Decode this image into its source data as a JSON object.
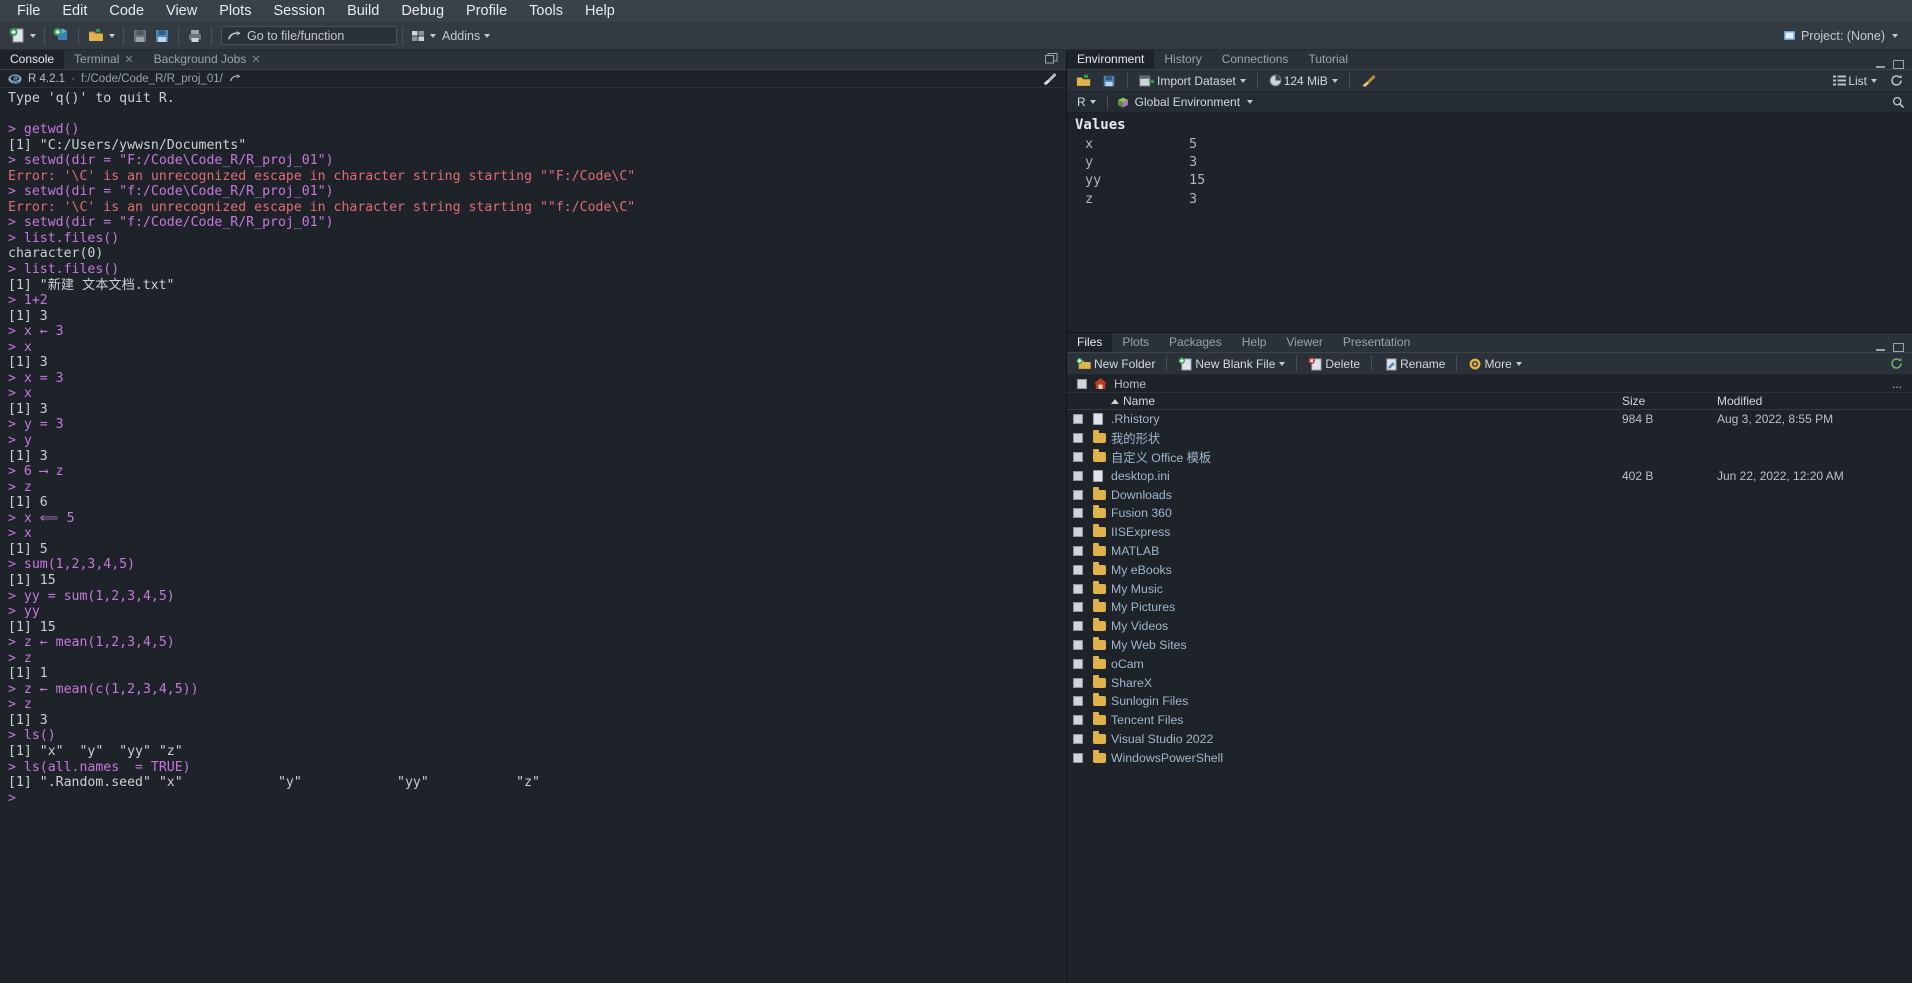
{
  "menubar": {
    "items": [
      {
        "label": "File"
      },
      {
        "label": "Edit"
      },
      {
        "label": "Code"
      },
      {
        "label": "View"
      },
      {
        "label": "Plots"
      },
      {
        "label": "Session"
      },
      {
        "label": "Build"
      },
      {
        "label": "Debug"
      },
      {
        "label": "Profile"
      },
      {
        "label": "Tools"
      },
      {
        "label": "Help"
      }
    ]
  },
  "toolbar": {
    "new_file_icon": "new-file-icon",
    "new_project_icon": "new-project-icon",
    "open_file_icon": "open-file-icon",
    "save_icon": "save-icon",
    "save_all_icon": "save-all-icon",
    "print_icon": "print-icon",
    "goto_icon": "goto-arrow-icon",
    "goto_label": "Go to file/function",
    "panes_icon": "panes-layout-icon",
    "addins_label": "Addins",
    "project_label": "Project: (None)"
  },
  "console": {
    "tabs": [
      {
        "label": "Console",
        "active": true,
        "closable": false
      },
      {
        "label": "Terminal",
        "active": false,
        "closable": true
      },
      {
        "label": "Background Jobs",
        "active": false,
        "closable": true
      }
    ],
    "r_version": "R 4.2.1",
    "separator": "·",
    "working_dir": "f:/Code/Code_R/R_proj_01/",
    "lines": [
      {
        "type": "out",
        "text": "Type 'q()' to quit R."
      },
      {
        "type": "blank",
        "text": ""
      },
      {
        "type": "cmd",
        "text": "> getwd()"
      },
      {
        "type": "out",
        "text": "[1] \"C:/Users/ywwsn/Documents\""
      },
      {
        "type": "cmd",
        "text": "> setwd(dir = \"F:/Code\\Code_R/R_proj_01\")"
      },
      {
        "type": "err",
        "text": "Error: '\\C' is an unrecognized escape in character string starting \"\"F:/Code\\C\""
      },
      {
        "type": "cmd",
        "text": "> setwd(dir = \"f:/Code\\Code_R/R_proj_01\")"
      },
      {
        "type": "err",
        "text": "Error: '\\C' is an unrecognized escape in character string starting \"\"f:/Code\\C\""
      },
      {
        "type": "cmd",
        "text": "> setwd(dir = \"f:/Code/Code_R/R_proj_01\")"
      },
      {
        "type": "cmd",
        "text": "> list.files()"
      },
      {
        "type": "out",
        "text": "character(0)"
      },
      {
        "type": "cmd",
        "text": "> list.files()"
      },
      {
        "type": "out",
        "text": "[1] \"新建 文本文档.txt\""
      },
      {
        "type": "cmd",
        "text": "> 1+2"
      },
      {
        "type": "out",
        "text": "[1] 3"
      },
      {
        "type": "cmd",
        "text": "> x ← 3"
      },
      {
        "type": "cmd",
        "text": "> x"
      },
      {
        "type": "out",
        "text": "[1] 3"
      },
      {
        "type": "cmd",
        "text": "> x = 3"
      },
      {
        "type": "cmd",
        "text": "> x"
      },
      {
        "type": "out",
        "text": "[1] 3"
      },
      {
        "type": "cmd",
        "text": "> y = 3"
      },
      {
        "type": "cmd",
        "text": "> y"
      },
      {
        "type": "out",
        "text": "[1] 3"
      },
      {
        "type": "cmd",
        "text": "> 6 ⟶ z"
      },
      {
        "type": "cmd",
        "text": "> z"
      },
      {
        "type": "out",
        "text": "[1] 6"
      },
      {
        "type": "cmd",
        "text": "> x ⟸ 5"
      },
      {
        "type": "cmd",
        "text": "> x"
      },
      {
        "type": "out",
        "text": "[1] 5"
      },
      {
        "type": "cmd",
        "text": "> sum(1,2,3,4,5)"
      },
      {
        "type": "out",
        "text": "[1] 15"
      },
      {
        "type": "cmd",
        "text": "> yy = sum(1,2,3,4,5)"
      },
      {
        "type": "cmd",
        "text": "> yy"
      },
      {
        "type": "out",
        "text": "[1] 15"
      },
      {
        "type": "cmd",
        "text": "> z ← mean(1,2,3,4,5)"
      },
      {
        "type": "cmd",
        "text": "> z"
      },
      {
        "type": "out",
        "text": "[1] 1"
      },
      {
        "type": "cmd",
        "text": "> z ← mean(c(1,2,3,4,5))"
      },
      {
        "type": "cmd",
        "text": "> z"
      },
      {
        "type": "out",
        "text": "[1] 3"
      },
      {
        "type": "cmd",
        "text": "> ls()"
      },
      {
        "type": "out",
        "text": "[1] \"x\"  \"y\"  \"yy\" \"z\""
      },
      {
        "type": "cmd",
        "text": "> ls(all.names  = TRUE)"
      },
      {
        "type": "out",
        "text": "[1] \".Random.seed\" \"x\"            \"y\"            \"yy\"           \"z\""
      },
      {
        "type": "cmd",
        "text": ">"
      }
    ]
  },
  "environment": {
    "tabs": [
      {
        "label": "Environment",
        "active": true
      },
      {
        "label": "History",
        "active": false
      },
      {
        "label": "Connections",
        "active": false
      },
      {
        "label": "Tutorial",
        "active": false
      }
    ],
    "toolbar": {
      "load_icon": "open-folder-icon",
      "save_icon": "save-icon",
      "import_icon": "import-dataset-icon",
      "import_label": "Import Dataset",
      "memory_icon": "memory-pie-icon",
      "memory_label": "124 MiB",
      "broom_icon": "clear-objects-broom-icon",
      "list_icon": "list-view-icon",
      "list_label": "List",
      "refresh_icon": "refresh-icon"
    },
    "scope": {
      "language_label": "R",
      "cube_icon": "r-package-cube-icon",
      "environment_label": "Global Environment",
      "search_icon": "search-icon"
    },
    "section_label": "Values",
    "values": [
      {
        "name": "x",
        "value": "5"
      },
      {
        "name": "y",
        "value": "3"
      },
      {
        "name": "yy",
        "value": "15"
      },
      {
        "name": "z",
        "value": "3"
      }
    ]
  },
  "files": {
    "tabs": [
      {
        "label": "Files",
        "active": true
      },
      {
        "label": "Plots",
        "active": false
      },
      {
        "label": "Packages",
        "active": false
      },
      {
        "label": "Help",
        "active": false
      },
      {
        "label": "Viewer",
        "active": false
      },
      {
        "label": "Presentation",
        "active": false
      }
    ],
    "toolbar": {
      "new_folder_icon": "new-folder-icon",
      "new_folder_label": "New Folder",
      "new_blank_file_icon": "new-blank-file-icon",
      "new_blank_file_label": "New Blank File",
      "delete_icon": "delete-icon",
      "delete_label": "Delete",
      "rename_icon": "rename-icon",
      "rename_label": "Rename",
      "more_icon": "more-gear-icon",
      "more_label": "More",
      "refresh_icon": "refresh-icon"
    },
    "breadcrumb": {
      "home_icon": "home-icon",
      "label": "Home",
      "overflow": "..."
    },
    "columns": {
      "name": "Name",
      "size": "Size",
      "modified": "Modified"
    },
    "rows": [
      {
        "icon": "rhistory-file-icon",
        "name": ".Rhistory",
        "size": "984 B",
        "modified": "Aug 3, 2022, 8:55 PM"
      },
      {
        "icon": "folder-icon",
        "name": "我的形状",
        "size": "",
        "modified": ""
      },
      {
        "icon": "folder-icon",
        "name": "自定义 Office 模板",
        "size": "",
        "modified": ""
      },
      {
        "icon": "ini-file-icon",
        "name": "desktop.ini",
        "size": "402 B",
        "modified": "Jun 22, 2022, 12:20 AM"
      },
      {
        "icon": "folder-icon",
        "name": "Downloads",
        "size": "",
        "modified": ""
      },
      {
        "icon": "folder-icon",
        "name": "Fusion 360",
        "size": "",
        "modified": ""
      },
      {
        "icon": "folder-icon",
        "name": "IISExpress",
        "size": "",
        "modified": ""
      },
      {
        "icon": "folder-icon",
        "name": "MATLAB",
        "size": "",
        "modified": ""
      },
      {
        "icon": "folder-icon",
        "name": "My eBooks",
        "size": "",
        "modified": ""
      },
      {
        "icon": "folder-icon",
        "name": "My Music",
        "size": "",
        "modified": ""
      },
      {
        "icon": "folder-icon",
        "name": "My Pictures",
        "size": "",
        "modified": ""
      },
      {
        "icon": "folder-icon",
        "name": "My Videos",
        "size": "",
        "modified": ""
      },
      {
        "icon": "folder-icon",
        "name": "My Web Sites",
        "size": "",
        "modified": ""
      },
      {
        "icon": "folder-icon",
        "name": "oCam",
        "size": "",
        "modified": ""
      },
      {
        "icon": "folder-icon",
        "name": "ShareX",
        "size": "",
        "modified": ""
      },
      {
        "icon": "folder-icon",
        "name": "Sunlogin Files",
        "size": "",
        "modified": ""
      },
      {
        "icon": "folder-icon",
        "name": "Tencent Files",
        "size": "",
        "modified": ""
      },
      {
        "icon": "folder-icon",
        "name": "Visual Studio 2022",
        "size": "",
        "modified": ""
      },
      {
        "icon": "folder-icon",
        "name": "WindowsPowerShell",
        "size": "",
        "modified": ""
      }
    ]
  },
  "colors": {
    "bg": "#1e2229",
    "panel": "#2b3138",
    "menubar": "#394249",
    "command": "#c678dd",
    "error": "#e06c75",
    "output": "#c9d0d6",
    "link": "#9fb6cc"
  }
}
